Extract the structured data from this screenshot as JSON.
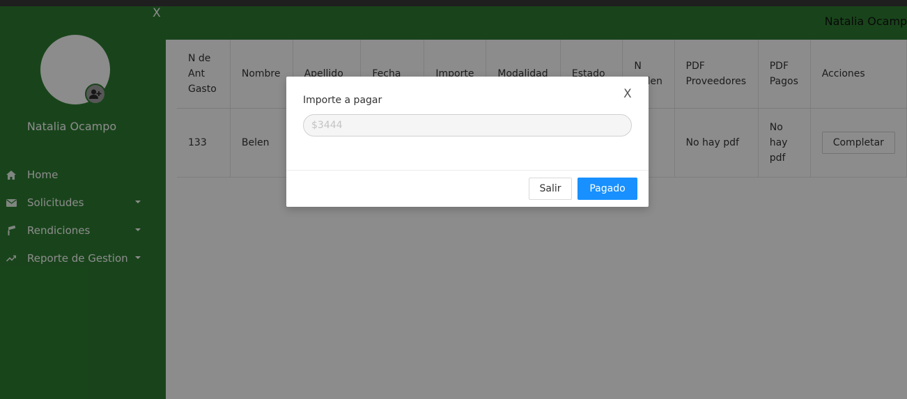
{
  "sidebar": {
    "close_glyph": "X",
    "user_name": "Natalia Ocampo",
    "items": [
      {
        "label": "Home",
        "icon": "home-icon",
        "has_caret": false
      },
      {
        "label": "Solicitudes",
        "icon": "mail-icon",
        "has_caret": true
      },
      {
        "label": "Rendiciones",
        "icon": "paint-roller-icon",
        "has_caret": true
      },
      {
        "label": "Reporte de Gestion",
        "icon": "trend-line-icon",
        "has_caret": true
      }
    ]
  },
  "header": {
    "user_name": "Natalia Ocampo"
  },
  "table": {
    "columns": [
      "N de Ant Gasto",
      "Nombre",
      "Apellido",
      "Fecha",
      "Importe",
      "Modalidad",
      "Estado",
      "N orden",
      "PDF Proveedores",
      "PDF Pagos",
      "Acciones"
    ],
    "rows": [
      {
        "n_ant_gasto": "133",
        "nombre": "Belen",
        "apellido": "",
        "fecha": "",
        "importe": "",
        "modalidad": "",
        "estado": "",
        "n_orden": "",
        "pdf_proveedores": "No hay pdf",
        "pdf_pagos": "No hay pdf",
        "accion_label": "Completar"
      }
    ]
  },
  "modal": {
    "close_glyph": "X",
    "label": "Importe a pagar",
    "input_placeholder": "$3444",
    "input_value": "",
    "cancel_label": "Salir",
    "confirm_label": "Pagado"
  },
  "colors": {
    "sidebar_bg": "#2e7d32",
    "primary_button": "#1890ff"
  }
}
